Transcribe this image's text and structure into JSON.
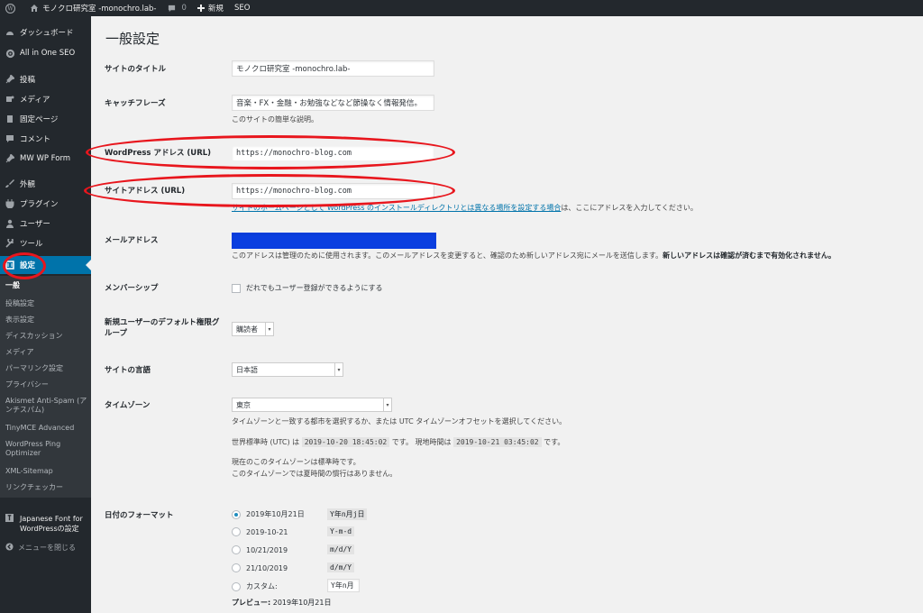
{
  "adminbar": {
    "site_name": "モノクロ研究室 -monochro.lab-",
    "comments_count": "0",
    "new_label": "新規",
    "seo_label": "SEO"
  },
  "sidebar": {
    "items": [
      {
        "label": "ダッシュボード",
        "icon": "dashboard-icon"
      },
      {
        "label": "All in One SEO",
        "icon": "gear-icon"
      },
      {
        "label": "投稿",
        "icon": "pin-icon"
      },
      {
        "label": "メディア",
        "icon": "media-icon"
      },
      {
        "label": "固定ページ",
        "icon": "page-icon"
      },
      {
        "label": "コメント",
        "icon": "comment-icon"
      },
      {
        "label": "MW WP Form",
        "icon": "pin-icon"
      },
      {
        "label": "外観",
        "icon": "brush-icon"
      },
      {
        "label": "プラグイン",
        "icon": "plugin-icon"
      },
      {
        "label": "ユーザー",
        "icon": "user-icon"
      },
      {
        "label": "ツール",
        "icon": "wrench-icon"
      },
      {
        "label": "設定",
        "icon": "settings-icon"
      }
    ],
    "submenu": [
      "一般",
      "投稿設定",
      "表示設定",
      "ディスカッション",
      "メディア",
      "パーマリンク設定",
      "プライバシー",
      "Akismet Anti-Spam (アンチスパム)",
      "TinyMCE Advanced",
      "WordPress Ping Optimizer",
      "XML-Sitemap",
      "リンクチェッカー"
    ],
    "japanese_font": "Japanese Font for WordPressの設定",
    "collapse": "メニューを閉じる"
  },
  "page": {
    "title": "一般設定",
    "site_title_label": "サイトのタイトル",
    "site_title_value": "モノクロ研究室 -monochro.lab-",
    "tagline_label": "キャッチフレーズ",
    "tagline_value": "音楽・FX・金融・お勉強などなど節操なく情報発信。",
    "tagline_desc": "このサイトの簡単な説明。",
    "wp_address_label": "WordPress アドレス (URL)",
    "wp_address_value": "https://monochro-blog.com",
    "site_address_label": "サイトアドレス (URL)",
    "site_address_value": "https://monochro-blog.com",
    "site_address_desc_link": "サイトのホームページとして WordPress のインストールディレクトリとは異なる場所を設定する場合",
    "site_address_desc_rest": "は、ここにアドレスを入力してください。",
    "email_label": "メールアドレス",
    "email_desc": "このアドレスは管理のために使用されます。このメールアドレスを変更すると、確認のため新しいアドレス宛にメールを送信します。",
    "email_desc_bold": "新しいアドレスは確認が済むまで有効化されません。",
    "membership_label": "メンバーシップ",
    "membership_checkbox": "だれでもユーザー登録ができるようにする",
    "default_role_label": "新規ユーザーのデフォルト権限グループ",
    "default_role_value": "購読者",
    "language_label": "サイトの言語",
    "language_value": "日本語",
    "timezone_label": "タイムゾーン",
    "timezone_value": "東京",
    "timezone_desc": "タイムゾーンと一致する都市を選択するか、または UTC タイムゾーンオフセットを選択してください。",
    "utc_prefix": "世界標準時 (UTC) は",
    "utc_time": "2019-10-20 18:45:02",
    "utc_mid": "です。 現地時間は",
    "local_time": "2019-10-21 03:45:02",
    "local_suffix": "です。",
    "std_time_desc": "現在のこのタイムゾーンは標準時です。",
    "dst_desc": "このタイムゾーンでは夏時間の慣行はありません。",
    "date_format_label": "日付のフォーマット",
    "date_formats": [
      {
        "label": "2019年10月21日",
        "code": "Y年n月j日",
        "checked": true
      },
      {
        "label": "2019-10-21",
        "code": "Y-m-d",
        "checked": false
      },
      {
        "label": "10/21/2019",
        "code": "m/d/Y",
        "checked": false
      },
      {
        "label": "21/10/2019",
        "code": "d/m/Y",
        "checked": false
      },
      {
        "label": "カスタム:",
        "code": "Y年n月",
        "checked": false
      }
    ],
    "preview_label": "プレビュー:",
    "preview_value": "2019年10月21日"
  },
  "colors": {
    "accent": "#0073aa",
    "annotation_red": "#e8161d",
    "email_redaction": "#0b3fe0"
  }
}
